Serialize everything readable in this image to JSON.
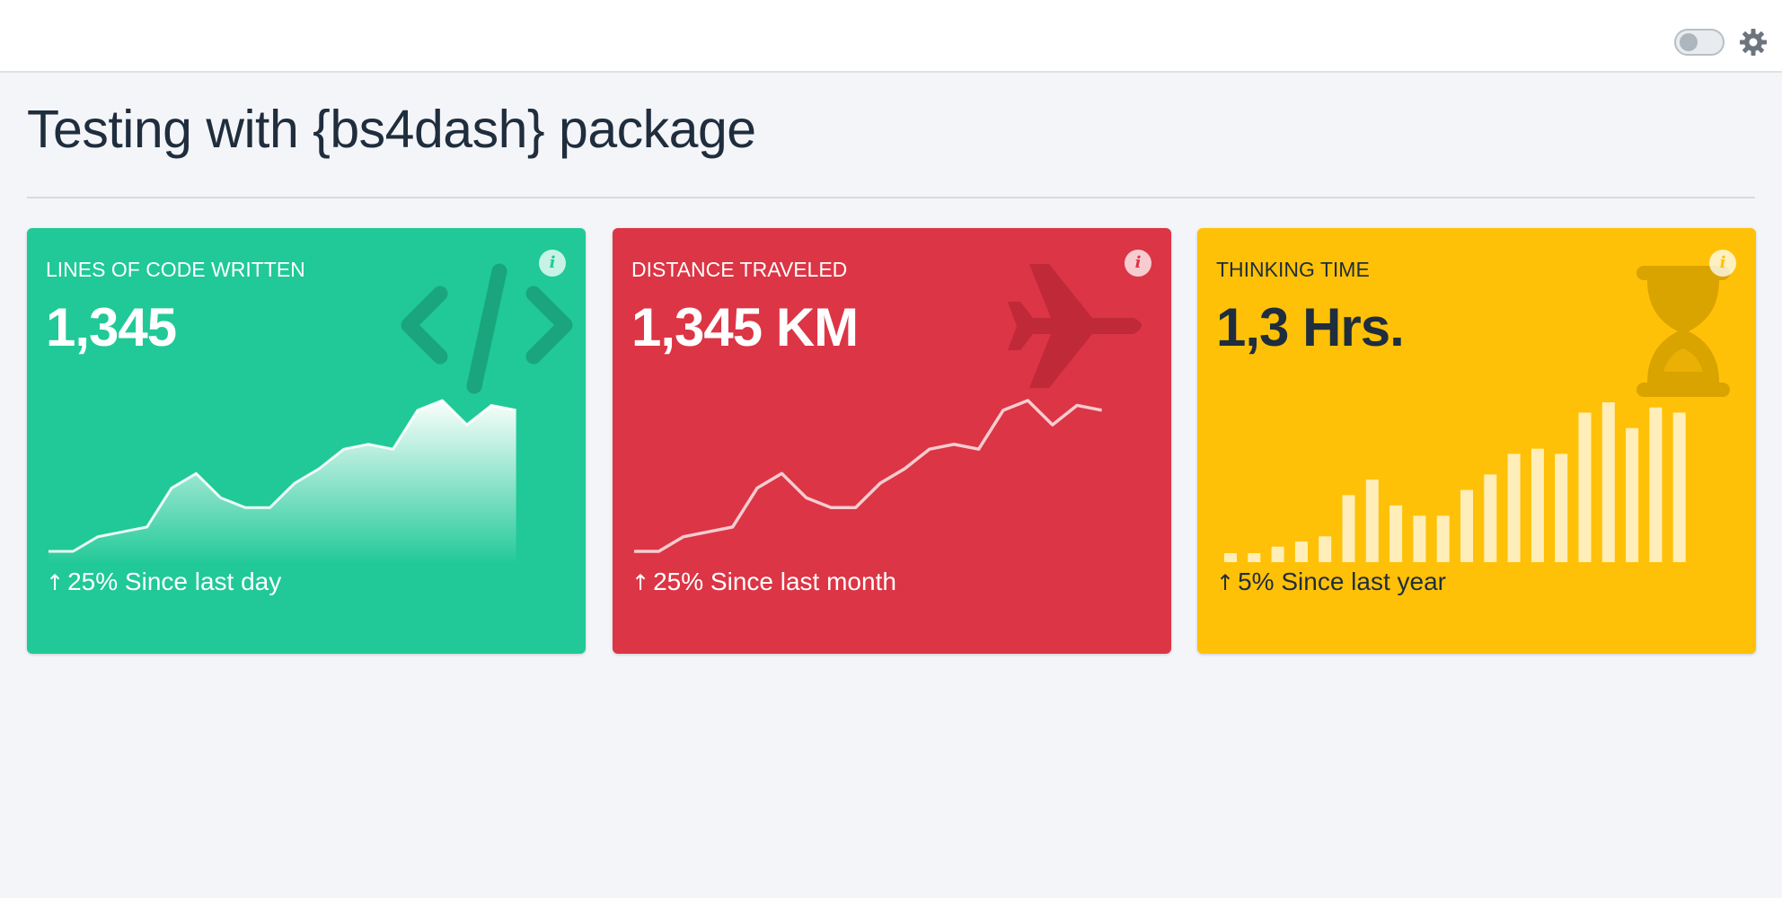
{
  "page": {
    "title": "Testing with {bs4dash} package"
  },
  "navbar": {
    "toggle_icon": "toggle-switch-icon",
    "settings_icon": "gear-icon"
  },
  "cards": [
    {
      "id": "lines-of-code",
      "label": "LINES OF CODE WRITTEN",
      "value": "1,345",
      "icon": "code-icon",
      "info_icon": "info-icon",
      "footer_arrow": "↑",
      "footer_text": "25% Since last day",
      "color": "#20c997",
      "sparkline": {
        "type": "area",
        "values": [
          0,
          0,
          3,
          4,
          5,
          13,
          16,
          11,
          9,
          9,
          14,
          17,
          21,
          22,
          21,
          29,
          31,
          26,
          30,
          29
        ]
      }
    },
    {
      "id": "distance-traveled",
      "label": "DISTANCE TRAVELED",
      "value": "1,345 KM",
      "icon": "plane-icon",
      "info_icon": "info-icon",
      "footer_arrow": "↑",
      "footer_text": "25% Since last month",
      "color": "#dc3545",
      "sparkline": {
        "type": "line",
        "values": [
          0,
          0,
          3,
          4,
          5,
          13,
          16,
          11,
          9,
          9,
          14,
          17,
          21,
          22,
          21,
          29,
          31,
          26,
          30,
          29
        ]
      }
    },
    {
      "id": "thinking-time",
      "label": "THINKING TIME",
      "value": "1,3 Hrs.",
      "icon": "hourglass-icon",
      "info_icon": "info-icon",
      "footer_arrow": "↑",
      "footer_text": "5% Since last year",
      "color": "#ffc107",
      "sparkline": {
        "type": "bar",
        "values": [
          0,
          0,
          3,
          4,
          5,
          13,
          16,
          11,
          9,
          9,
          14,
          17,
          21,
          22,
          21,
          29,
          31,
          26,
          30,
          29
        ]
      }
    }
  ]
}
